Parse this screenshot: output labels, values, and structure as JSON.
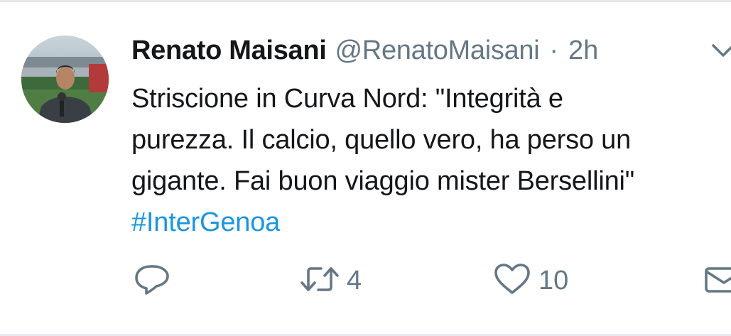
{
  "tweet": {
    "author": {
      "name": "Renato Maisani",
      "handle": "@RenatoMaisani"
    },
    "separator": "·",
    "timestamp": "2h",
    "text_lines": [
      "Striscione in Curva Nord: \"Integrità e",
      "purezza. Il calcio, quello vero, ha perso un",
      "gigante. Fai buon viaggio mister Bersellini\""
    ],
    "hashtag": "#InterGenoa"
  },
  "actions": {
    "reply": {
      "icon": "reply-icon"
    },
    "retweet": {
      "icon": "retweet-icon",
      "count": "4"
    },
    "like": {
      "icon": "heart-icon",
      "count": "10"
    },
    "direct_message": {
      "icon": "envelope-icon"
    }
  },
  "colors": {
    "text": "#14171a",
    "secondary": "#657786",
    "link": "#1b95e0"
  }
}
